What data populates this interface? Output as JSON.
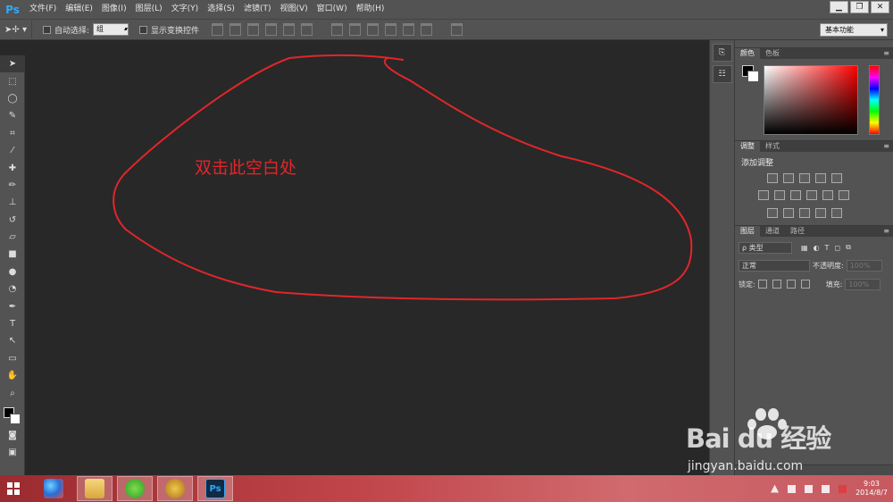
{
  "app": {
    "logo": "Ps"
  },
  "menu": {
    "items": [
      "文件(F)",
      "编辑(E)",
      "图像(I)",
      "图层(L)",
      "文字(Y)",
      "选择(S)",
      "滤镜(T)",
      "视图(V)",
      "窗口(W)",
      "帮助(H)"
    ]
  },
  "window_controls": {
    "minimize": "▁",
    "restore": "❐",
    "close": "✕"
  },
  "options_bar": {
    "tool_icon": "move-tool",
    "auto_select_label": "自动选择:",
    "auto_select_value": "组",
    "show_transform_label": "显示变换控件",
    "workspace": "基本功能"
  },
  "canvas": {
    "annotation_text": "双击此空白处",
    "annotation_color": "#e1262a"
  },
  "color_panel": {
    "tabs": [
      "颜色",
      "色板"
    ],
    "fg_color": "#000000",
    "bg_color": "#ffffff"
  },
  "adjustments_panel": {
    "tabs": [
      "调整",
      "样式"
    ],
    "title": "添加调整"
  },
  "layers_panel": {
    "tabs": [
      "图层",
      "通道",
      "路径"
    ],
    "filter_label": "ρ 类型",
    "blend_mode": "正常",
    "opacity_label": "不透明度:",
    "opacity_value": "100%",
    "lock_label": "锁定:",
    "fill_label": "填充:",
    "fill_value": "100%"
  },
  "taskbar": {
    "clock_time": "9:03",
    "clock_date": "2014/8/7"
  },
  "watermark": {
    "brand": "Bai du 经验",
    "url": "jingyan.baidu.com"
  }
}
